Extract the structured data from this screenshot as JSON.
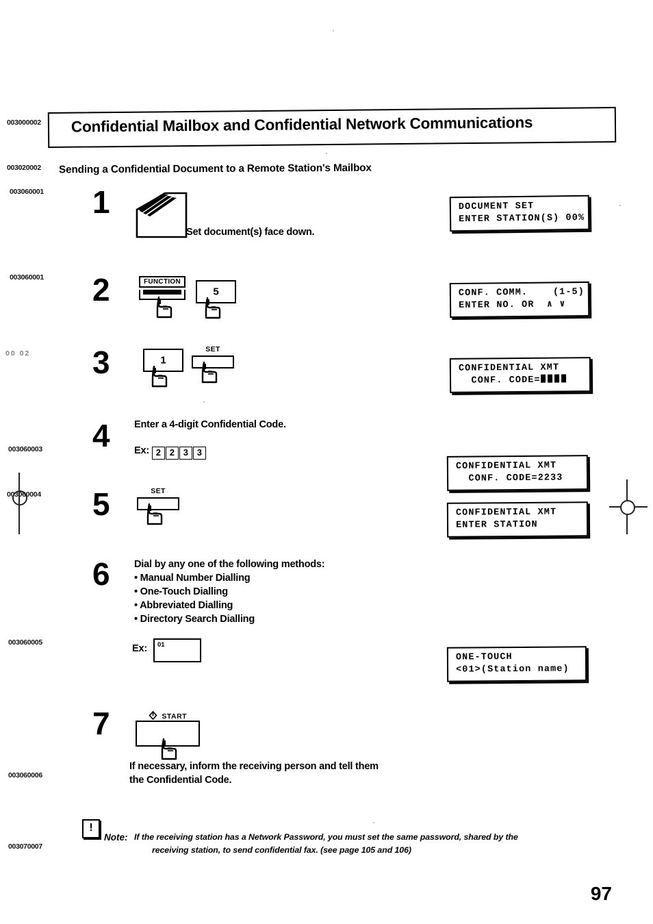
{
  "header": {
    "title": "Confidential Mailbox and Confidential Network Communications",
    "subtitle": "Sending a Confidential Document to a Remote Station's Mailbox"
  },
  "margin_codes": [
    {
      "text": "003000002",
      "faded": false
    },
    {
      "text": "003020002",
      "faded": false
    },
    {
      "text": "003060001",
      "faded": false
    },
    {
      "text": "003060001",
      "faded": false
    },
    {
      "text": "00       02",
      "faded": true
    },
    {
      "text": "003060003",
      "faded": false
    },
    {
      "text": "003060004",
      "faded": false
    },
    {
      "text": "003060005",
      "faded": false
    },
    {
      "text": "003060006",
      "faded": false
    },
    {
      "text": "003070007",
      "faded": false
    }
  ],
  "steps": {
    "one": {
      "number": "1",
      "caption": "Set document(s) face down.",
      "icon": "document-tray-icon"
    },
    "two": {
      "number": "2",
      "key_function": "FUNCTION",
      "key_five": "5"
    },
    "three": {
      "number": "3",
      "key_one": "1",
      "key_set": "SET"
    },
    "four": {
      "number": "4",
      "instruction": "Enter a 4-digit Confidential Code.",
      "example_label": "Ex:",
      "example_digits": [
        "2",
        "2",
        "3",
        "3"
      ]
    },
    "five": {
      "number": "5",
      "key_set": "SET"
    },
    "six": {
      "number": "6",
      "intro": "Dial by any one of the following methods:",
      "methods": [
        "Manual Number Dialling",
        "One-Touch Dialling",
        "Abbreviated Dialling",
        "Directory Search Dialling"
      ],
      "example_label": "Ex:",
      "example_key": "01"
    },
    "seven": {
      "number": "7",
      "key_start": "START",
      "start_icon": "power-start-icon",
      "note_line1": "If necessary, inform the receiving person and tell them",
      "note_line2": "the Confidential Code."
    }
  },
  "lcd_panels": {
    "p1": {
      "line1": "DOCUMENT SET",
      "line2": "ENTER STATION(S) 00%"
    },
    "p2": {
      "line1": "CONF. COMM.    (1-5)",
      "line2": "ENTER NO. OR  ∧ ∨"
    },
    "p3": {
      "line1": "CONFIDENTIAL XMT",
      "line2_prefix": "  CONF. CODE=",
      "line2_blocks": 4
    },
    "p4": {
      "line1": "CONFIDENTIAL XMT",
      "line2": "  CONF. CODE=2233"
    },
    "p5": {
      "line1": "CONFIDENTIAL XMT",
      "line2": "ENTER STATION"
    },
    "p6": {
      "line1": "ONE-TOUCH",
      "line2": "<01>(Station name)"
    }
  },
  "note": {
    "icon": "exclamation-icon",
    "bang": "!",
    "label": "Note:",
    "line1": "If the receiving station has a Network Password, you must set the same password, shared by the",
    "line2": "receiving station, to send confidential fax. (see page 105 and 106)"
  },
  "page_number": "97"
}
